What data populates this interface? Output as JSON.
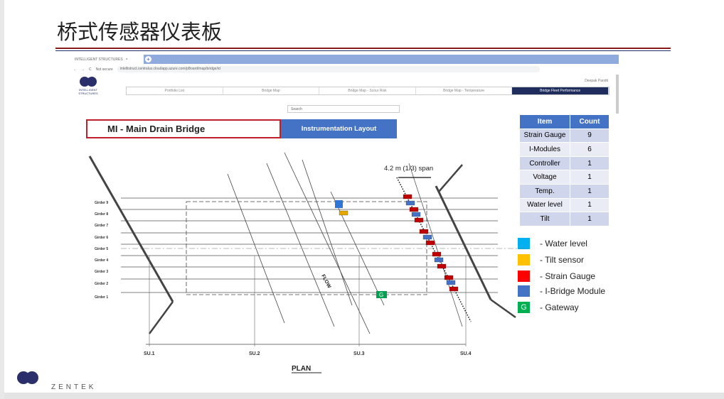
{
  "slide": {
    "title": "桥式传感器仪表板"
  },
  "browser": {
    "tab_title": "INTELLIGENT STRUCTURES",
    "security": "Not secure",
    "url": "intellistruct.centralus.cloudapp.azure.com/pBoard/map/bridge/id",
    "user": "Deepak Pandit",
    "nav_tabs": [
      "Portfolio List",
      "Bridge Map",
      "Bridge Map - Scour Risk",
      "Bridge Map - Temperature",
      "Bridge Fleet Performance"
    ],
    "active_tab": "Bridge Fleet Performance",
    "search_placeholder": "Search",
    "logo_text": "INTELLIGENT STRUCTURES"
  },
  "bridge": {
    "name": "MI - Main Drain Bridge",
    "layout_button": "Instrumentation Layout"
  },
  "table": {
    "headers": [
      "Item",
      "Count"
    ],
    "rows": [
      [
        "Strain Gauge",
        "9"
      ],
      [
        "I-Modules",
        "6"
      ],
      [
        "Controller",
        "1"
      ],
      [
        "Voltage",
        "1"
      ],
      [
        "Temp.",
        "1"
      ],
      [
        "Water level",
        "1"
      ],
      [
        "Tilt",
        "1"
      ]
    ]
  },
  "legend": [
    {
      "label": "- Water level",
      "color": "#00b0f0",
      "symbol": ""
    },
    {
      "label": "- Tilt sensor",
      "color": "#ffc000",
      "symbol": ""
    },
    {
      "label": "- Strain Gauge",
      "color": "#ff0000",
      "symbol": ""
    },
    {
      "label": "- I-Bridge Module",
      "color": "#4472c4",
      "symbol": ""
    },
    {
      "label": "- Gateway",
      "color": "#00b050",
      "symbol": "G"
    }
  ],
  "diagram": {
    "girders": [
      "Girder 9",
      "Girder 8",
      "Girder 7",
      "Girder 6",
      "Girder 5",
      "Girder 4",
      "Girder 3",
      "Girder 2",
      "Girder 1"
    ],
    "supports": [
      "SU.1",
      "SU.2",
      "SU.3",
      "SU.4"
    ],
    "plan_label": "PLAN",
    "span_label": "4.2 m (1/3) span",
    "flow_label": "FLOW",
    "gateway_symbol": "G"
  },
  "footer": {
    "logo1": "INTELLIGENT STRUCTURES",
    "logo2": "ZENTEK"
  }
}
